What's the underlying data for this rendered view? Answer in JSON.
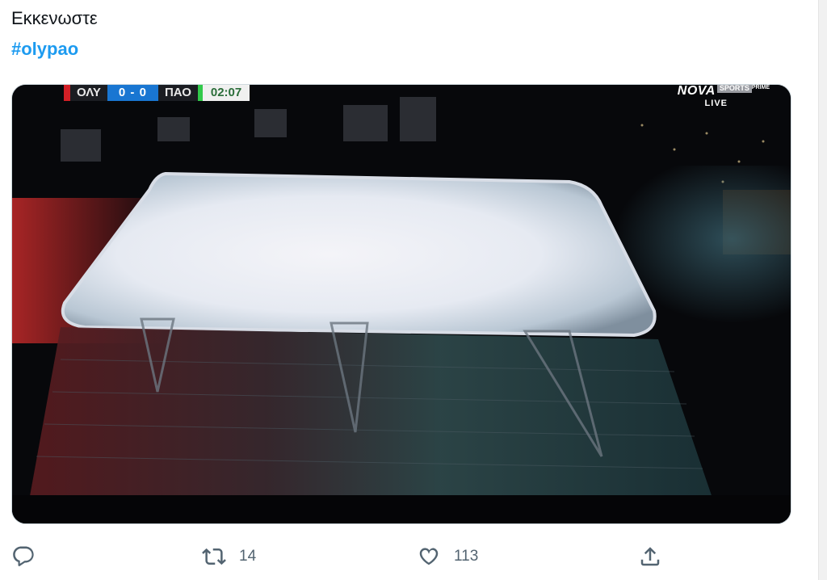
{
  "tweet": {
    "text": "Εκκενωστε",
    "hashtag": "#olypao"
  },
  "media": {
    "description_icon": "video-frame",
    "scoreboard": {
      "home_team": "ΟΛΥ",
      "score": "0 - 0",
      "away_team": "ΠΑΟ",
      "clock": "02:07",
      "home_color": "#d31f26",
      "away_color": "#31c94a"
    },
    "broadcaster": {
      "name": "NOVA",
      "channel": "SPORTS",
      "tier": "PRIME",
      "status": "LIVE"
    }
  },
  "actions": {
    "reply": {
      "icon": "reply-icon",
      "count": ""
    },
    "retweet": {
      "icon": "retweet-icon",
      "count": "14"
    },
    "like": {
      "icon": "heart-icon",
      "count": "113"
    },
    "share": {
      "icon": "share-icon",
      "count": ""
    }
  },
  "colors": {
    "hashtag": "#1d9bf0",
    "text": "#0f1419",
    "muted": "#536471"
  }
}
